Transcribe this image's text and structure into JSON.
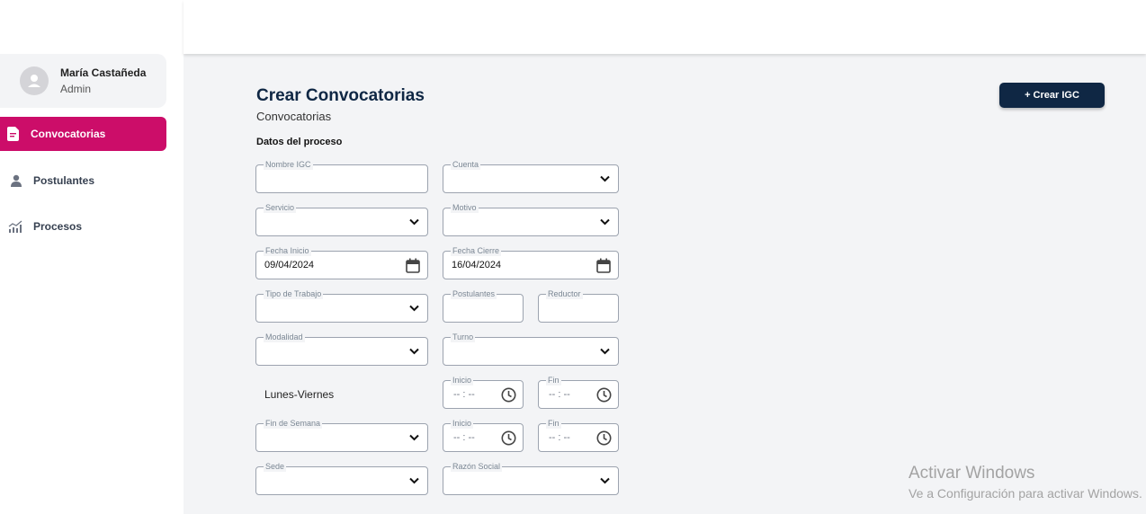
{
  "user": {
    "name": "María Castañeda",
    "role": "Admin"
  },
  "nav": [
    {
      "label": "Convocatorias",
      "icon": "document-icon",
      "active": true
    },
    {
      "label": "Postulantes",
      "icon": "person-icon",
      "active": false
    },
    {
      "label": "Procesos",
      "icon": "chart-icon",
      "active": false
    }
  ],
  "header": {
    "title": "Crear Convocatorias",
    "subtitle": "Convocatorias",
    "create_button": "+ Crear IGC"
  },
  "section": {
    "title": "Datos del proceso"
  },
  "form": {
    "nombre_igc": {
      "label": "Nombre IGC",
      "value": ""
    },
    "cuenta": {
      "label": "Cuenta",
      "value": ""
    },
    "servicio": {
      "label": "Servicio",
      "value": ""
    },
    "motivo": {
      "label": "Motivo",
      "value": ""
    },
    "fecha_inicio": {
      "label": "Fecha Inicio",
      "value": "09/04/2024"
    },
    "fecha_cierre": {
      "label": "Fecha Cierre",
      "value": "16/04/2024"
    },
    "tipo_trabajo": {
      "label": "Tipo de Trabajo",
      "value": ""
    },
    "postulantes": {
      "label": "Postulantes",
      "value": ""
    },
    "reductor": {
      "label": "Reductor",
      "value": ""
    },
    "modalidad": {
      "label": "Modalidad",
      "value": ""
    },
    "turno": {
      "label": "Turno",
      "value": ""
    },
    "lunes_viernes": {
      "label": "Lunes-Viernes"
    },
    "lv_inicio": {
      "label": "Inicio",
      "value": "-- : --"
    },
    "lv_fin": {
      "label": "Fin",
      "value": "-- : --"
    },
    "fin_semana": {
      "label": "Fin de Semana",
      "value": ""
    },
    "fs_inicio": {
      "label": "Inicio",
      "value": "-- : --"
    },
    "fs_fin": {
      "label": "Fin",
      "value": "-- : --"
    },
    "sede": {
      "label": "Sede",
      "value": ""
    },
    "razon_social": {
      "label": "Razón Social",
      "value": ""
    }
  },
  "watermark": {
    "line1": "Activar Windows",
    "line2": "Ve a Configuración para activar Windows."
  },
  "colors": {
    "accent": "#cc0d69",
    "navy": "#0f2744",
    "background": "#f3f4f6"
  }
}
